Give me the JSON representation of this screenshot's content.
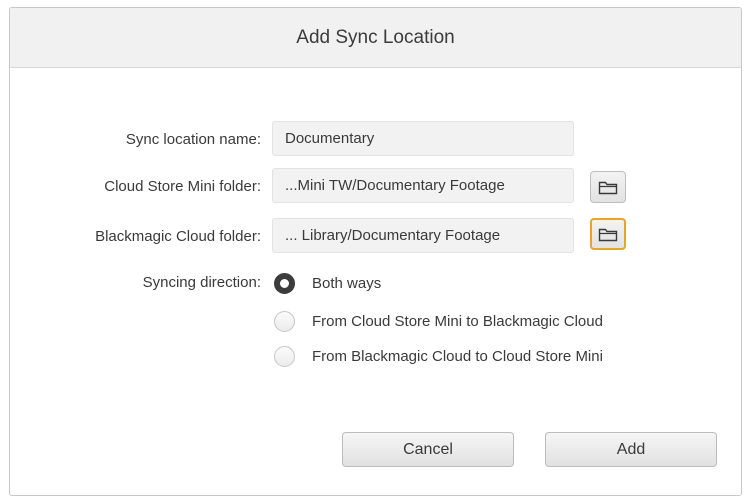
{
  "dialog": {
    "title": "Add Sync Location",
    "sync_name": {
      "label": "Sync location name:",
      "value": "Documentary"
    },
    "mini_folder": {
      "label": "Cloud Store Mini folder:",
      "value": "...Mini TW/Documentary Footage",
      "button_icon": "folder-icon"
    },
    "cloud_folder": {
      "label": "Blackmagic Cloud folder:",
      "value": "... Library/Documentary Footage",
      "button_icon": "folder-icon"
    },
    "direction": {
      "label": "Syncing direction:",
      "options": [
        {
          "label": "Both ways",
          "selected": true
        },
        {
          "label": "From Cloud Store Mini to Blackmagic Cloud",
          "selected": false
        },
        {
          "label": "From Blackmagic Cloud to Cloud Store Mini",
          "selected": false
        }
      ]
    },
    "cancel_label": "Cancel",
    "add_label": "Add"
  },
  "colors": {
    "focus_ring": "#e9a52b",
    "titlebar_bg": "#f1f1f1",
    "field_bg": "#f2f2f2"
  }
}
